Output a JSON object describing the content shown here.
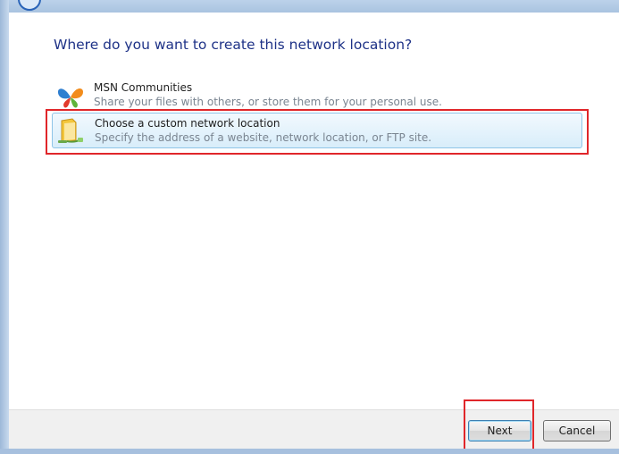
{
  "dialog": {
    "heading": "Where do you want to create this network location?"
  },
  "options": [
    {
      "title": "MSN Communities",
      "description": "Share your files with others, or store them for your personal use.",
      "icon": "msn-butterfly-icon",
      "selected": false
    },
    {
      "title": "Choose a custom network location",
      "description": "Specify the address of a website, network location, or FTP site.",
      "icon": "folder-network-icon",
      "selected": true
    }
  ],
  "buttons": {
    "next": "Next",
    "cancel": "Cancel"
  },
  "colors": {
    "heading": "#1e3287",
    "highlight": "#e0262a",
    "selection_border": "#8fc5e8"
  }
}
